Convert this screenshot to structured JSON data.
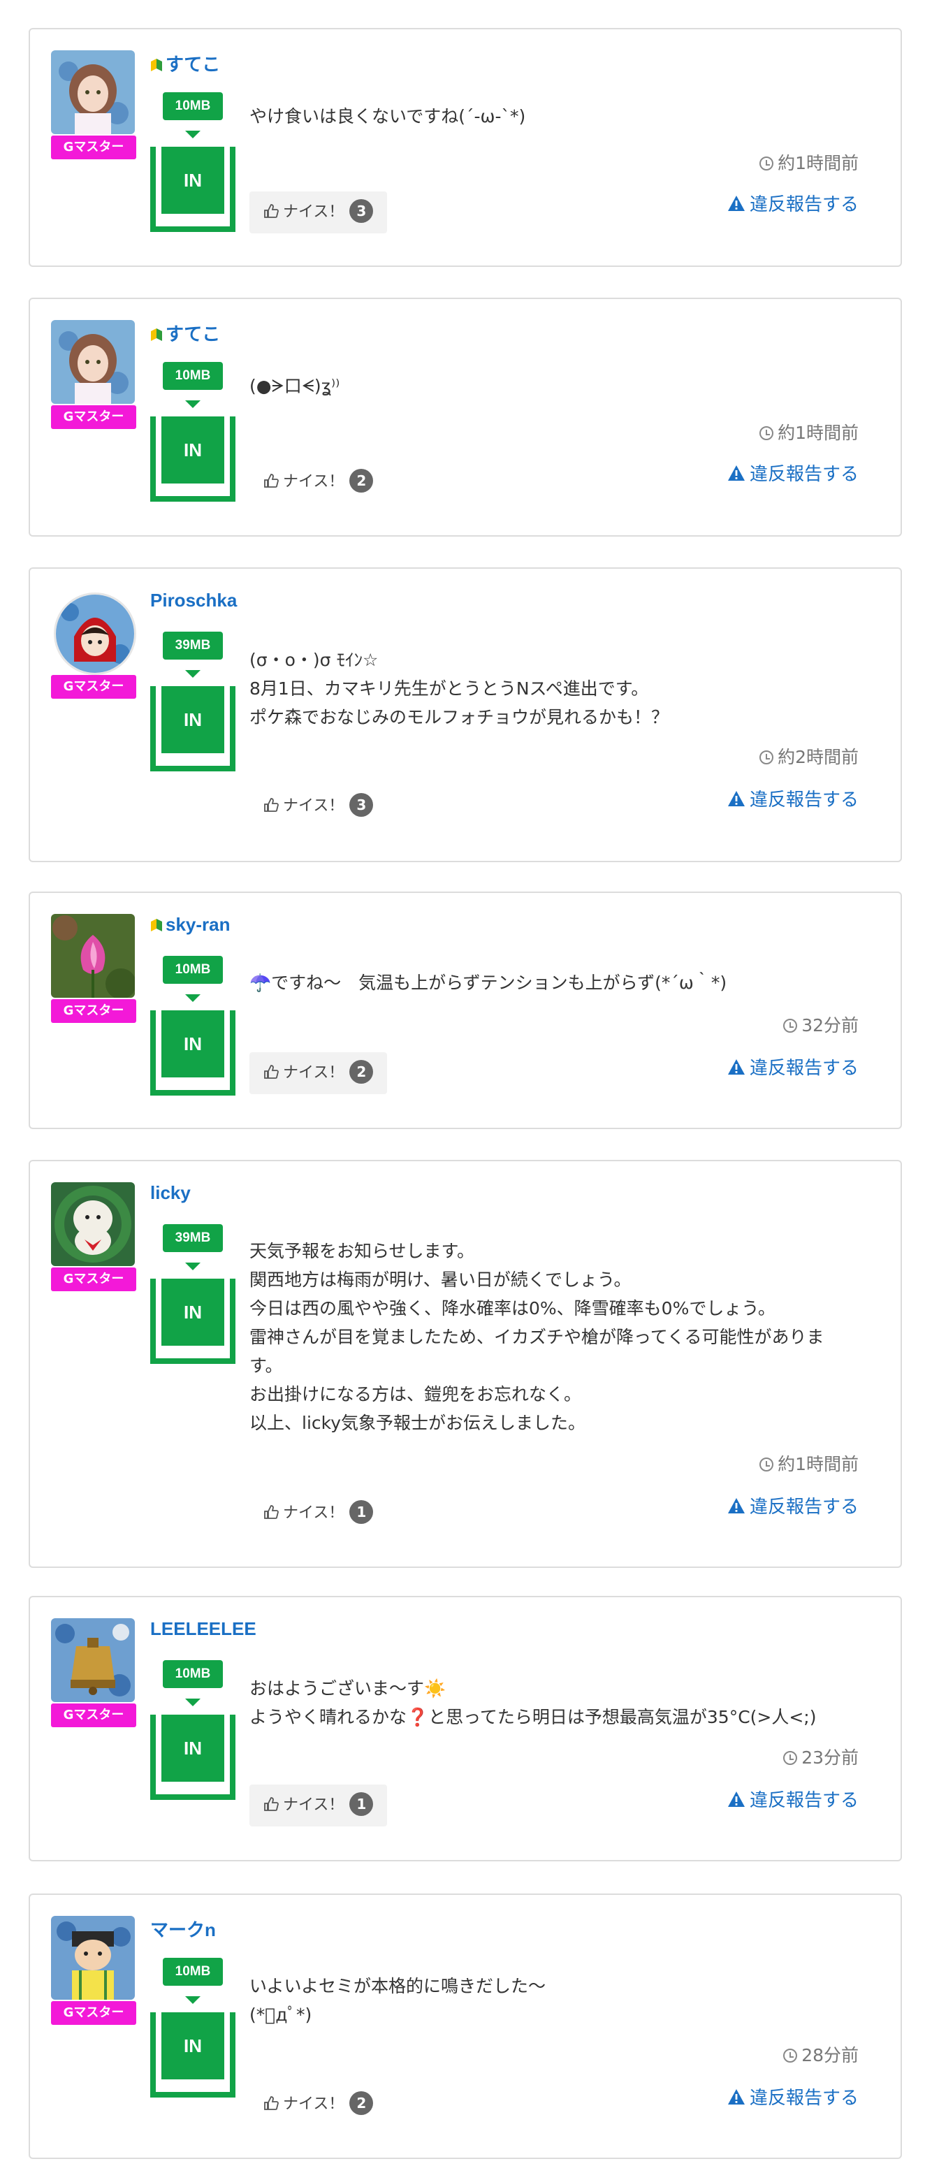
{
  "common": {
    "badge": "Gマスター",
    "in_label": "IN",
    "nice_label": "ナイス！",
    "report_label": "違反報告する"
  },
  "posts": [
    {
      "user": "すてこ",
      "beginner": true,
      "size": "10MB",
      "message": "やけ食いは良くないですね(´-ω-`*)",
      "time": "約1時間前",
      "nice": "3",
      "avatar": "girl"
    },
    {
      "user": "すてこ",
      "beginner": true,
      "size": "10MB",
      "message": "(●ᗒ口ᗕ)ʓ⁾⁾",
      "time": "約1時間前",
      "nice": "2",
      "avatar": "girl"
    },
    {
      "user": "Piroschka",
      "beginner": false,
      "size": "39MB",
      "message": "(σ・o・)σ ﾓｲﾝ☆\n8月1日、カマキリ先生がとうとうNスペ進出です。\nポケ森でおなじみのモルフォチョウが見れるかも！？",
      "time": "約2時間前",
      "nice": "3",
      "avatar": "red"
    },
    {
      "user": "sky-ran",
      "beginner": true,
      "size": "10MB",
      "message": "☂️ですね〜　気温も上がらずテンションも上がらず(*´ω｀*)",
      "time": "32分前",
      "nice": "2",
      "avatar": "flower"
    },
    {
      "user": "licky",
      "beginner": false,
      "size": "39MB",
      "message": "天気予報をお知らせします。\n関西地方は梅雨が明け、暑い日が続くでしょう。\n今日は西の風やや強く、降水確率は0%、降雪確率も0%でしょう。\n雷神さんが目を覚ましたため、イカズチや槍が降ってくる可能性がありま\nす。\nお出掛けになる方は、鎧兜をお忘れなく。\n以上、licky気象予報士がお伝えしました。",
      "time": "約1時間前",
      "nice": "1",
      "avatar": "dog"
    },
    {
      "user": "LEELEELEE",
      "beginner": false,
      "size": "10MB",
      "message": "おはようございま〜す☀️\nようやく晴れるかな❓と思ってたら明日は予想最高気温が35°C(>人<;)",
      "time": "23分前",
      "nice": "1",
      "avatar": "bell"
    },
    {
      "user": "マークn",
      "beginner": false,
      "size": "10MB",
      "message": "いよいよセミが本格的に鳴きだした〜\n(*ﾟдﾟ*)",
      "time": "28分前",
      "nice": "2",
      "avatar": "boy"
    }
  ],
  "colors": {
    "accent": "#11a347",
    "link": "#1a6fc4",
    "badge": "#f319d8"
  }
}
